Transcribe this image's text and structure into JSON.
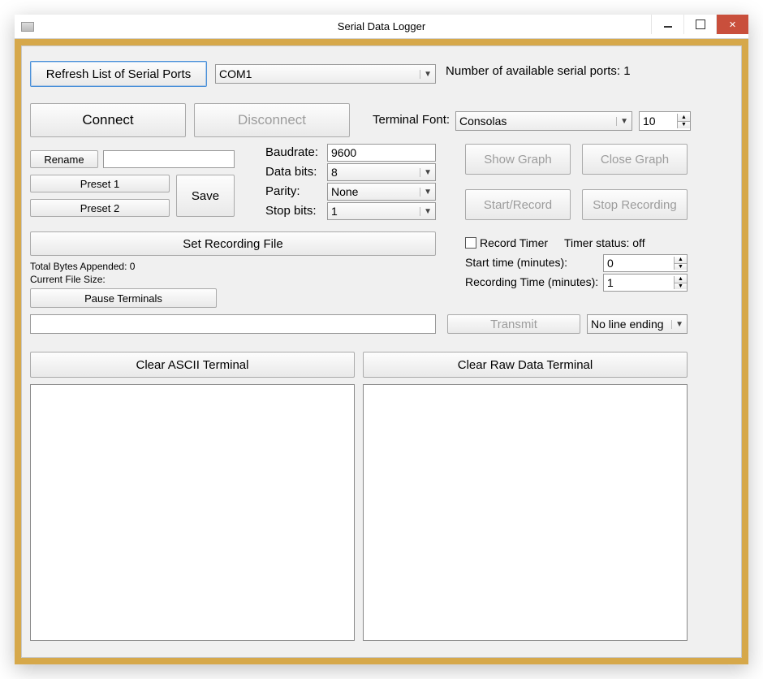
{
  "window": {
    "title": "Serial Data Logger"
  },
  "refresh_button": "Refresh List of Serial Ports",
  "port_select": "COM1",
  "ports_count_label": "Number of available serial ports: 1",
  "connect_btn": "Connect",
  "disconnect_btn": "Disconnect",
  "terminalfont_label": "Terminal Font:",
  "font_select": "Consolas",
  "fontsize_value": "10",
  "rename_btn": "Rename",
  "rename_input": "",
  "save_btn": "Save",
  "preset1_btn": "Preset 1",
  "preset2_btn": "Preset 2",
  "baud_label": "Baudrate:",
  "baud_value": "9600",
  "databits_label": "Data bits:",
  "databits_value": "8",
  "parity_label": "Parity:",
  "parity_value": "None",
  "stopbits_label": "Stop bits:",
  "stopbits_value": "1",
  "showgraph_btn": "Show Graph",
  "closegraph_btn": "Close Graph",
  "startrec_btn": "Start/Record",
  "stoprec_btn": "Stop Recording",
  "setfile_btn": "Set Recording File",
  "total_bytes_label": "Total Bytes Appended: 0",
  "current_size_label": "Current File Size:",
  "pause_btn": "Pause Terminals",
  "recordtimer_label": "Record Timer",
  "timerstatus_label": "Timer status: off",
  "starttime_label": "Start time (minutes):",
  "starttime_value": "0",
  "rectime_label": "Recording Time (minutes):",
  "rectime_value": "1",
  "tx_input": "",
  "transmit_btn": "Transmit",
  "lineending_select": "No line ending",
  "clear_ascii_btn": "Clear ASCII Terminal",
  "clear_raw_btn": "Clear Raw Data Terminal"
}
